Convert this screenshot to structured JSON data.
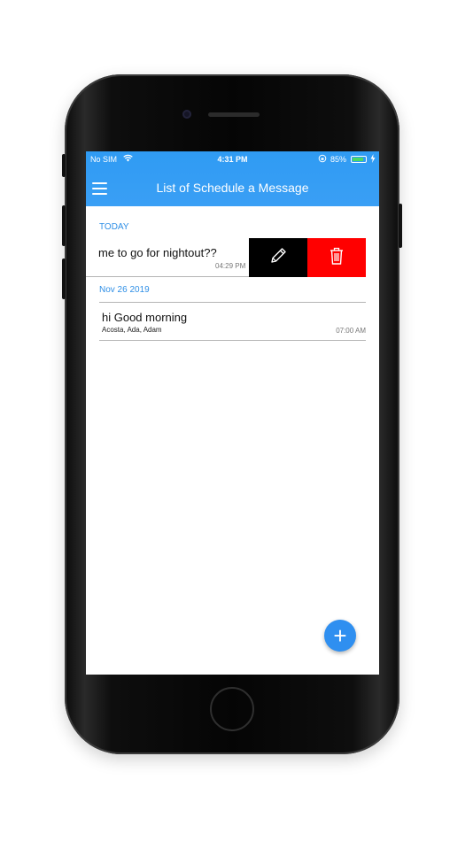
{
  "status_bar": {
    "carrier": "No SIM",
    "time": "4:31 PM",
    "battery_percent": "85%",
    "battery_level": 0.85,
    "icons": [
      "wifi-icon",
      "orientation-lock-icon",
      "battery-icon",
      "charging-icon"
    ]
  },
  "header": {
    "menu_icon": "hamburger-menu-icon",
    "title": "List of Schedule a Message"
  },
  "sections": [
    {
      "label": "TODAY",
      "items": [
        {
          "message": "me to go for nightout??",
          "time": "04:29 PM",
          "actions": [
            {
              "name": "edit",
              "icon": "pencil-icon",
              "color": "#000000"
            },
            {
              "name": "delete",
              "icon": "trash-icon",
              "color": "#ff0000"
            }
          ]
        }
      ]
    },
    {
      "label": "Nov 26 2019",
      "items": [
        {
          "message": "hi Good morning",
          "recipients": "Acosta, Ada, Adam",
          "time": "07:00 AM"
        }
      ]
    }
  ],
  "fab": {
    "icon": "plus-icon",
    "label": "+"
  },
  "colors": {
    "accent": "#2f9bf3",
    "delete": "#ff0000",
    "edit": "#000000"
  }
}
